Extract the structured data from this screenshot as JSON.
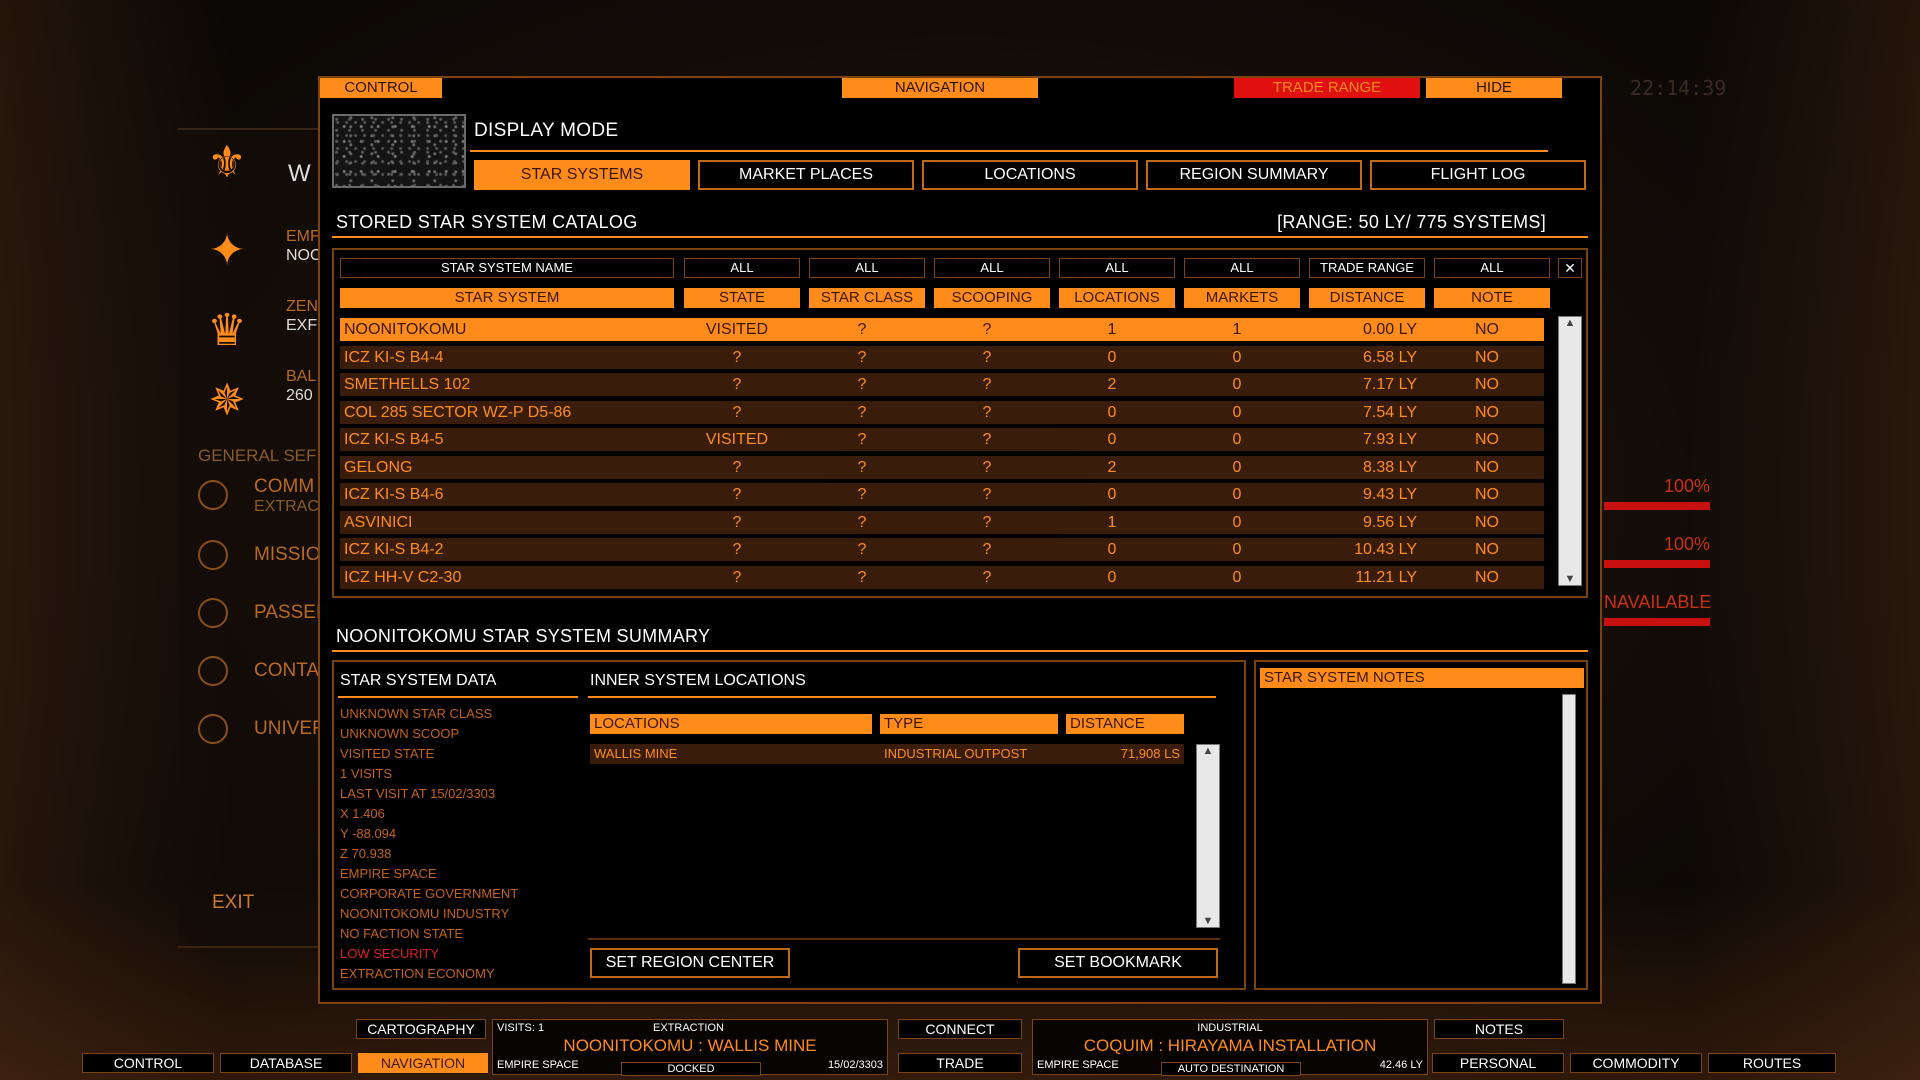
{
  "top_buttons": {
    "control": "CONTROL",
    "navigation": "NAVIGATION",
    "trade_range": "TRADE RANGE",
    "hide": "HIDE"
  },
  "display_mode": {
    "title": "DISPLAY MODE",
    "tabs": [
      "STAR SYSTEMS",
      "MARKET PLACES",
      "LOCATIONS",
      "REGION SUMMARY",
      "FLIGHT LOG"
    ],
    "active_tab": 0
  },
  "catalog": {
    "title": "STORED STAR SYSTEM CATALOG",
    "range": "[RANGE: 50 LY/ 775 SYSTEMS]",
    "filters": [
      "STAR SYSTEM NAME",
      "ALL",
      "ALL",
      "ALL",
      "ALL",
      "ALL",
      "TRADE RANGE",
      "ALL"
    ],
    "clear_filter": "✕",
    "columns": [
      "STAR SYSTEM",
      "STATE",
      "STAR CLASS",
      "SCOOPING",
      "LOCATIONS",
      "MARKETS",
      "DISTANCE",
      "NOTE"
    ],
    "rows": [
      {
        "name": "NOONITOKOMU",
        "state": "VISITED",
        "star_class": "?",
        "scooping": "?",
        "locations": "1",
        "markets": "1",
        "distance": "0.00 LY",
        "note": "NO"
      },
      {
        "name": "ICZ KI-S B4-4",
        "state": "?",
        "star_class": "?",
        "scooping": "?",
        "locations": "0",
        "markets": "0",
        "distance": "6.58 LY",
        "note": "NO"
      },
      {
        "name": "SMETHELLS 102",
        "state": "?",
        "star_class": "?",
        "scooping": "?",
        "locations": "2",
        "markets": "0",
        "distance": "7.17 LY",
        "note": "NO"
      },
      {
        "name": "COL 285 SECTOR WZ-P D5-86",
        "state": "?",
        "star_class": "?",
        "scooping": "?",
        "locations": "0",
        "markets": "0",
        "distance": "7.54 LY",
        "note": "NO"
      },
      {
        "name": "ICZ KI-S B4-5",
        "state": "VISITED",
        "star_class": "?",
        "scooping": "?",
        "locations": "0",
        "markets": "0",
        "distance": "7.93 LY",
        "note": "NO"
      },
      {
        "name": "GELONG",
        "state": "?",
        "star_class": "?",
        "scooping": "?",
        "locations": "2",
        "markets": "0",
        "distance": "8.38 LY",
        "note": "NO"
      },
      {
        "name": "ICZ KI-S B4-6",
        "state": "?",
        "star_class": "?",
        "scooping": "?",
        "locations": "0",
        "markets": "0",
        "distance": "9.43 LY",
        "note": "NO"
      },
      {
        "name": "ASVINICI",
        "state": "?",
        "star_class": "?",
        "scooping": "?",
        "locations": "1",
        "markets": "0",
        "distance": "9.56 LY",
        "note": "NO"
      },
      {
        "name": "ICZ KI-S B4-2",
        "state": "?",
        "star_class": "?",
        "scooping": "?",
        "locations": "0",
        "markets": "0",
        "distance": "10.43 LY",
        "note": "NO"
      },
      {
        "name": "ICZ HH-V C2-30",
        "state": "?",
        "star_class": "?",
        "scooping": "?",
        "locations": "0",
        "markets": "0",
        "distance": "11.21 LY",
        "note": "NO"
      }
    ],
    "selected_row": 0
  },
  "summary": {
    "title": "NOONITOKOMU STAR SYSTEM SUMMARY",
    "data_title": "STAR SYSTEM DATA",
    "data_lines": [
      "UNKNOWN STAR CLASS",
      "UNKNOWN SCOOP",
      "VISITED STATE",
      "1 VISITS",
      "LAST VISIT AT 15/02/3303",
      "X    1.406",
      "Y    -88.094",
      "Z    70.938",
      "EMPIRE SPACE",
      "CORPORATE GOVERNMENT",
      "NOONITOKOMU INDUSTRY",
      "NO FACTION STATE",
      "LOW SECURITY",
      "EXTRACTION ECONOMY"
    ],
    "highlight_line": 12,
    "inner_title": "INNER SYSTEM LOCATIONS",
    "loc_columns": [
      "LOCATIONS",
      "TYPE",
      "DISTANCE"
    ],
    "locations": [
      {
        "name": "WALLIS MINE",
        "type": "INDUSTRIAL OUTPOST",
        "distance": "71,908 LS"
      }
    ],
    "set_region_center": "SET REGION CENTER",
    "set_bookmark": "SET BOOKMARK",
    "notes_title": "STAR SYSTEM NOTES"
  },
  "background": {
    "left_partial": [
      "W",
      "EMF",
      "NOO",
      "ZEN",
      "EXF",
      "BAL",
      "260"
    ],
    "general": "GENERAL SEF",
    "menu": [
      {
        "label": "COMM",
        "sub": "Extractic"
      },
      {
        "label": "MISSIO",
        "sub": ""
      },
      {
        "label": "PASSEN",
        "sub": ""
      },
      {
        "label": "CONTA",
        "sub": ""
      },
      {
        "label": "UNIVER",
        "sub": ""
      }
    ],
    "exit": "EXIT",
    "right_pcts": [
      "100%",
      "100%"
    ],
    "right_status": "NAVAILABLE",
    "clock": "22:14:39"
  },
  "hud": {
    "cartography": "CARTOGRAPHY",
    "left_info": {
      "visits": "VISITS: 1",
      "economy": "EXTRACTION",
      "location": "NOONITOKOMU : WALLIS MINE",
      "space": "EMPIRE SPACE",
      "date": "15/02/3303",
      "status": "DOCKED"
    },
    "connect": "CONNECT",
    "trade": "TRADE",
    "right_info": {
      "economy": "INDUSTRIAL",
      "location": "COQUIM : HIRAYAMA INSTALLATION",
      "space": "EMPIRE SPACE",
      "distance": "42.46 LY",
      "status": "AUTO DESTINATION"
    },
    "notes": "NOTES",
    "bottom_tabs": [
      "CONTROL",
      "DATABASE",
      "NAVIGATION",
      "PERSONAL",
      "COMMODITY",
      "ROUTES"
    ],
    "active_bottom": "NAVIGATION"
  }
}
